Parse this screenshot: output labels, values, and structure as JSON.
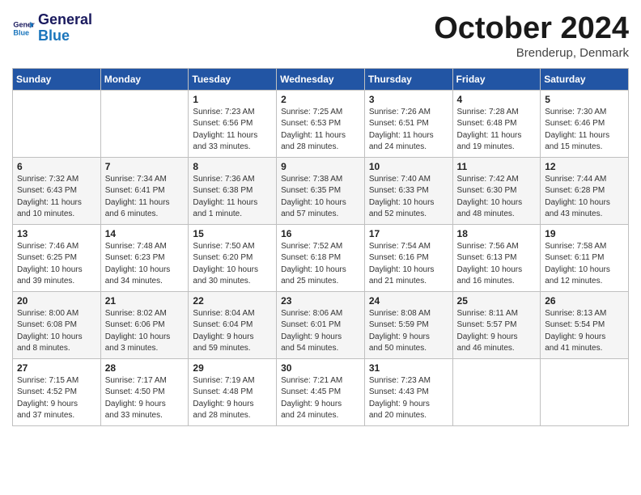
{
  "logo": {
    "line1": "General",
    "line2": "Blue"
  },
  "title": "October 2024",
  "subtitle": "Brenderup, Denmark",
  "days_header": [
    "Sunday",
    "Monday",
    "Tuesday",
    "Wednesday",
    "Thursday",
    "Friday",
    "Saturday"
  ],
  "weeks": [
    [
      {
        "num": "",
        "info": ""
      },
      {
        "num": "",
        "info": ""
      },
      {
        "num": "1",
        "info": "Sunrise: 7:23 AM\nSunset: 6:56 PM\nDaylight: 11 hours\nand 33 minutes."
      },
      {
        "num": "2",
        "info": "Sunrise: 7:25 AM\nSunset: 6:53 PM\nDaylight: 11 hours\nand 28 minutes."
      },
      {
        "num": "3",
        "info": "Sunrise: 7:26 AM\nSunset: 6:51 PM\nDaylight: 11 hours\nand 24 minutes."
      },
      {
        "num": "4",
        "info": "Sunrise: 7:28 AM\nSunset: 6:48 PM\nDaylight: 11 hours\nand 19 minutes."
      },
      {
        "num": "5",
        "info": "Sunrise: 7:30 AM\nSunset: 6:46 PM\nDaylight: 11 hours\nand 15 minutes."
      }
    ],
    [
      {
        "num": "6",
        "info": "Sunrise: 7:32 AM\nSunset: 6:43 PM\nDaylight: 11 hours\nand 10 minutes."
      },
      {
        "num": "7",
        "info": "Sunrise: 7:34 AM\nSunset: 6:41 PM\nDaylight: 11 hours\nand 6 minutes."
      },
      {
        "num": "8",
        "info": "Sunrise: 7:36 AM\nSunset: 6:38 PM\nDaylight: 11 hours\nand 1 minute."
      },
      {
        "num": "9",
        "info": "Sunrise: 7:38 AM\nSunset: 6:35 PM\nDaylight: 10 hours\nand 57 minutes."
      },
      {
        "num": "10",
        "info": "Sunrise: 7:40 AM\nSunset: 6:33 PM\nDaylight: 10 hours\nand 52 minutes."
      },
      {
        "num": "11",
        "info": "Sunrise: 7:42 AM\nSunset: 6:30 PM\nDaylight: 10 hours\nand 48 minutes."
      },
      {
        "num": "12",
        "info": "Sunrise: 7:44 AM\nSunset: 6:28 PM\nDaylight: 10 hours\nand 43 minutes."
      }
    ],
    [
      {
        "num": "13",
        "info": "Sunrise: 7:46 AM\nSunset: 6:25 PM\nDaylight: 10 hours\nand 39 minutes."
      },
      {
        "num": "14",
        "info": "Sunrise: 7:48 AM\nSunset: 6:23 PM\nDaylight: 10 hours\nand 34 minutes."
      },
      {
        "num": "15",
        "info": "Sunrise: 7:50 AM\nSunset: 6:20 PM\nDaylight: 10 hours\nand 30 minutes."
      },
      {
        "num": "16",
        "info": "Sunrise: 7:52 AM\nSunset: 6:18 PM\nDaylight: 10 hours\nand 25 minutes."
      },
      {
        "num": "17",
        "info": "Sunrise: 7:54 AM\nSunset: 6:16 PM\nDaylight: 10 hours\nand 21 minutes."
      },
      {
        "num": "18",
        "info": "Sunrise: 7:56 AM\nSunset: 6:13 PM\nDaylight: 10 hours\nand 16 minutes."
      },
      {
        "num": "19",
        "info": "Sunrise: 7:58 AM\nSunset: 6:11 PM\nDaylight: 10 hours\nand 12 minutes."
      }
    ],
    [
      {
        "num": "20",
        "info": "Sunrise: 8:00 AM\nSunset: 6:08 PM\nDaylight: 10 hours\nand 8 minutes."
      },
      {
        "num": "21",
        "info": "Sunrise: 8:02 AM\nSunset: 6:06 PM\nDaylight: 10 hours\nand 3 minutes."
      },
      {
        "num": "22",
        "info": "Sunrise: 8:04 AM\nSunset: 6:04 PM\nDaylight: 9 hours\nand 59 minutes."
      },
      {
        "num": "23",
        "info": "Sunrise: 8:06 AM\nSunset: 6:01 PM\nDaylight: 9 hours\nand 54 minutes."
      },
      {
        "num": "24",
        "info": "Sunrise: 8:08 AM\nSunset: 5:59 PM\nDaylight: 9 hours\nand 50 minutes."
      },
      {
        "num": "25",
        "info": "Sunrise: 8:11 AM\nSunset: 5:57 PM\nDaylight: 9 hours\nand 46 minutes."
      },
      {
        "num": "26",
        "info": "Sunrise: 8:13 AM\nSunset: 5:54 PM\nDaylight: 9 hours\nand 41 minutes."
      }
    ],
    [
      {
        "num": "27",
        "info": "Sunrise: 7:15 AM\nSunset: 4:52 PM\nDaylight: 9 hours\nand 37 minutes."
      },
      {
        "num": "28",
        "info": "Sunrise: 7:17 AM\nSunset: 4:50 PM\nDaylight: 9 hours\nand 33 minutes."
      },
      {
        "num": "29",
        "info": "Sunrise: 7:19 AM\nSunset: 4:48 PM\nDaylight: 9 hours\nand 28 minutes."
      },
      {
        "num": "30",
        "info": "Sunrise: 7:21 AM\nSunset: 4:45 PM\nDaylight: 9 hours\nand 24 minutes."
      },
      {
        "num": "31",
        "info": "Sunrise: 7:23 AM\nSunset: 4:43 PM\nDaylight: 9 hours\nand 20 minutes."
      },
      {
        "num": "",
        "info": ""
      },
      {
        "num": "",
        "info": ""
      }
    ]
  ]
}
